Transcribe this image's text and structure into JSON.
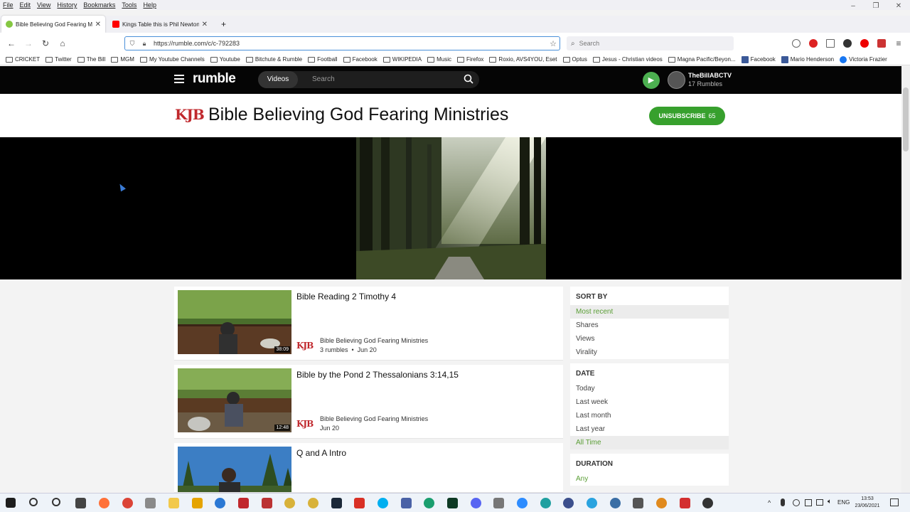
{
  "menubar": {
    "items": [
      "File",
      "Edit",
      "View",
      "History",
      "Bookmarks",
      "Tools",
      "Help"
    ]
  },
  "window_controls": {
    "minimize": "–",
    "restore": "❐",
    "close": "✕"
  },
  "tabs": [
    {
      "title": "Bible Believing God Fearing Ministries",
      "active": true,
      "favicon_color": "#85c742"
    },
    {
      "title": "Kings Table this is Phil Newton - YouTube",
      "active": false,
      "favicon_color": "#ff0000"
    }
  ],
  "new_tab": "+",
  "nav": {
    "back": "←",
    "forward": "→",
    "reload": "↻",
    "home": "⌂",
    "url": "https://rumble.com/c/c-792283",
    "search_placeholder": "Search"
  },
  "bookmarks": [
    {
      "label": "CRICKET",
      "type": "folder"
    },
    {
      "label": "Twitter",
      "type": "folder"
    },
    {
      "label": "The Bill",
      "type": "folder"
    },
    {
      "label": "MGM",
      "type": "folder"
    },
    {
      "label": "My Youtube Channels",
      "type": "folder"
    },
    {
      "label": "Youtube",
      "type": "folder"
    },
    {
      "label": "Bitchute & Rumble",
      "type": "folder"
    },
    {
      "label": "Football",
      "type": "folder"
    },
    {
      "label": "Facebook",
      "type": "folder"
    },
    {
      "label": "WIKIPEDIA",
      "type": "folder"
    },
    {
      "label": "Music",
      "type": "folder"
    },
    {
      "label": "Firefox",
      "type": "folder"
    },
    {
      "label": "Roxio, AVS4YOU, Eset",
      "type": "folder"
    },
    {
      "label": "Optus",
      "type": "folder"
    },
    {
      "label": "Jesus - Christian videos",
      "type": "folder"
    },
    {
      "label": "Magna Pacific/Beyon...",
      "type": "folder"
    },
    {
      "label": "Facebook",
      "type": "fb"
    },
    {
      "label": "Mario Henderson",
      "type": "fb"
    },
    {
      "label": "Victoria Frazier",
      "type": "fb"
    }
  ],
  "rumble_header": {
    "logo": "rumble",
    "videos_label": "Videos",
    "search_placeholder": "Search",
    "user_name": "TheBillABCTV",
    "user_rumbles": "17 Rumbles"
  },
  "channel": {
    "logo_text": "KJB",
    "title": "Bible Believing God Fearing Ministries",
    "unsubscribe_label": "UNSUBSCRIBE",
    "subscriber_count": "65"
  },
  "videos": [
    {
      "title": "Bible Reading 2 Timothy 4",
      "duration": "38:09",
      "channel": "Bible Believing God Fearing Ministries",
      "rumbles": "3 rumbles",
      "date": "Jun 20"
    },
    {
      "title": "Bible by the Pond 2 Thessalonians 3:14,15",
      "duration": "12:48",
      "channel": "Bible Believing God Fearing Ministries",
      "rumbles": "",
      "date": "Jun 20"
    },
    {
      "title": "Q and A Intro",
      "duration": "",
      "channel": "",
      "rumbles": "",
      "date": ""
    }
  ],
  "sidebar": {
    "sort": {
      "heading": "SORT BY",
      "items": [
        "Most recent",
        "Shares",
        "Views",
        "Virality"
      ],
      "selected": 0
    },
    "date": {
      "heading": "DATE",
      "items": [
        "Today",
        "Last week",
        "Last month",
        "Last year",
        "All Time"
      ],
      "selected": 4
    },
    "duration": {
      "heading": "DURATION",
      "items": [
        "Any"
      ],
      "selected": 0
    }
  },
  "taskbar": {
    "clock_time": "13:53",
    "clock_date": "23/06/2021",
    "lang": "ENG"
  },
  "colors": {
    "rumble_green": "#85c742",
    "unsubscribe_green": "#37a02d",
    "kjb_red": "#c0282d"
  }
}
